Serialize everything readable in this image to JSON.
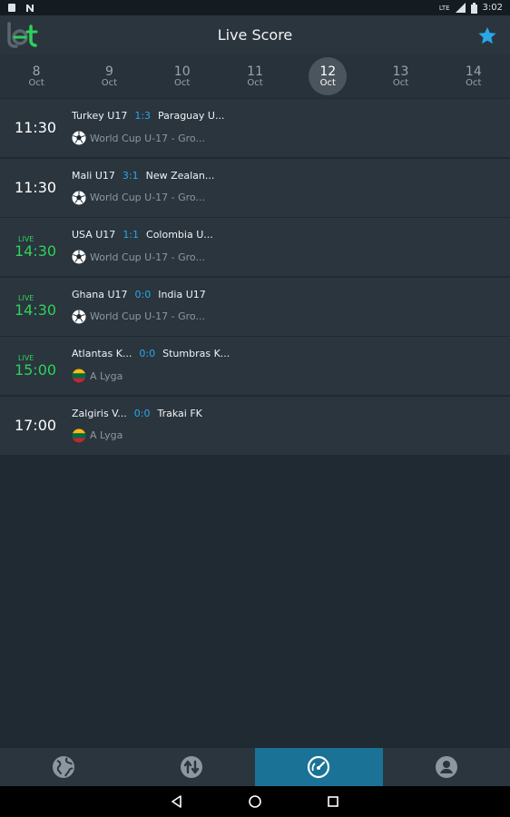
{
  "statusbar": {
    "time": "3:02",
    "network": "LTE"
  },
  "appbar": {
    "title": "Live Score"
  },
  "dates": [
    {
      "day": "8",
      "month": "Oct",
      "active": false
    },
    {
      "day": "9",
      "month": "Oct",
      "active": false
    },
    {
      "day": "10",
      "month": "Oct",
      "active": false
    },
    {
      "day": "11",
      "month": "Oct",
      "active": false
    },
    {
      "day": "12",
      "month": "Oct",
      "active": true
    },
    {
      "day": "13",
      "month": "Oct",
      "active": false
    },
    {
      "day": "14",
      "month": "Oct",
      "active": false
    }
  ],
  "matches": [
    {
      "live": "",
      "time": "11:30",
      "home": "Turkey U17",
      "score": "1:3",
      "away": "Paraguay U...",
      "competition": "World Cup U-17 - Gro...",
      "icon": "soccer-ball-icon"
    },
    {
      "live": "",
      "time": "11:30",
      "home": "Mali U17",
      "score": "3:1",
      "away": "New Zealan...",
      "competition": "World Cup U-17 - Gro...",
      "icon": "soccer-ball-icon"
    },
    {
      "live": "LIVE",
      "time": "14:30",
      "home": "USA U17",
      "score": "1:1",
      "away": "Colombia U...",
      "competition": "World Cup U-17 - Gro...",
      "icon": "soccer-ball-icon"
    },
    {
      "live": "LIVE",
      "time": "14:30",
      "home": "Ghana U17",
      "score": "0:0",
      "away": "India U17",
      "competition": "World Cup U-17 - Gro...",
      "icon": "soccer-ball-icon"
    },
    {
      "live": "LIVE",
      "time": "15:00",
      "home": "Atlantas K...",
      "score": "0:0",
      "away": "Stumbras K...",
      "competition": "A Lyga",
      "icon": "lithuania-flag-icon"
    },
    {
      "live": "",
      "time": "17:00",
      "home": "Zalgiris V...",
      "score": "0:0",
      "away": "Trakai FK",
      "competition": "A Lyga",
      "icon": "lithuania-flag-icon"
    }
  ],
  "bottom_nav": [
    {
      "icon": "globe-icon",
      "active": false
    },
    {
      "icon": "swap-icon",
      "active": false
    },
    {
      "icon": "speedometer-icon",
      "active": true
    },
    {
      "icon": "profile-icon",
      "active": false
    }
  ],
  "colors": {
    "accent": "#2aa7e6",
    "live": "#2ed158",
    "active_tab": "#1a7396"
  }
}
